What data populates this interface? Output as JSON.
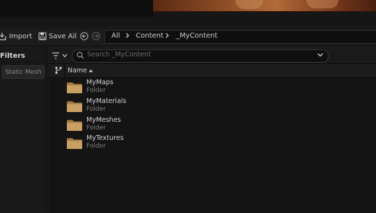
{
  "toolbar": {
    "import_label": "Import",
    "save_all_label": "Save All"
  },
  "breadcrumb": {
    "items": [
      "All",
      "Content",
      "_MyContent"
    ]
  },
  "filters": {
    "title": "Filters",
    "chip_label": "Static Mesh"
  },
  "search": {
    "placeholder": "Search _MyContent"
  },
  "list": {
    "column_header": "Name",
    "items": [
      {
        "name": "MyMaps",
        "type": "Folder"
      },
      {
        "name": "MyMaterials",
        "type": "Folder"
      },
      {
        "name": "MyMeshes",
        "type": "Folder"
      },
      {
        "name": "MyTextures",
        "type": "Folder"
      }
    ]
  },
  "icons": {
    "import": "import-icon",
    "save_all": "save-icon",
    "back": "back-arrow-icon",
    "forward": "forward-arrow-icon",
    "chevron": "chevron-right-icon",
    "filter": "filter-icon",
    "search": "search-icon",
    "dropdown": "chevron-down-icon",
    "folder": "folder-icon",
    "sort": "sort-ascending-icon"
  },
  "colors": {
    "background": "#1a1a1a",
    "folder": "#c9a064",
    "text": "#d4d4d4",
    "subtext": "#808080"
  }
}
